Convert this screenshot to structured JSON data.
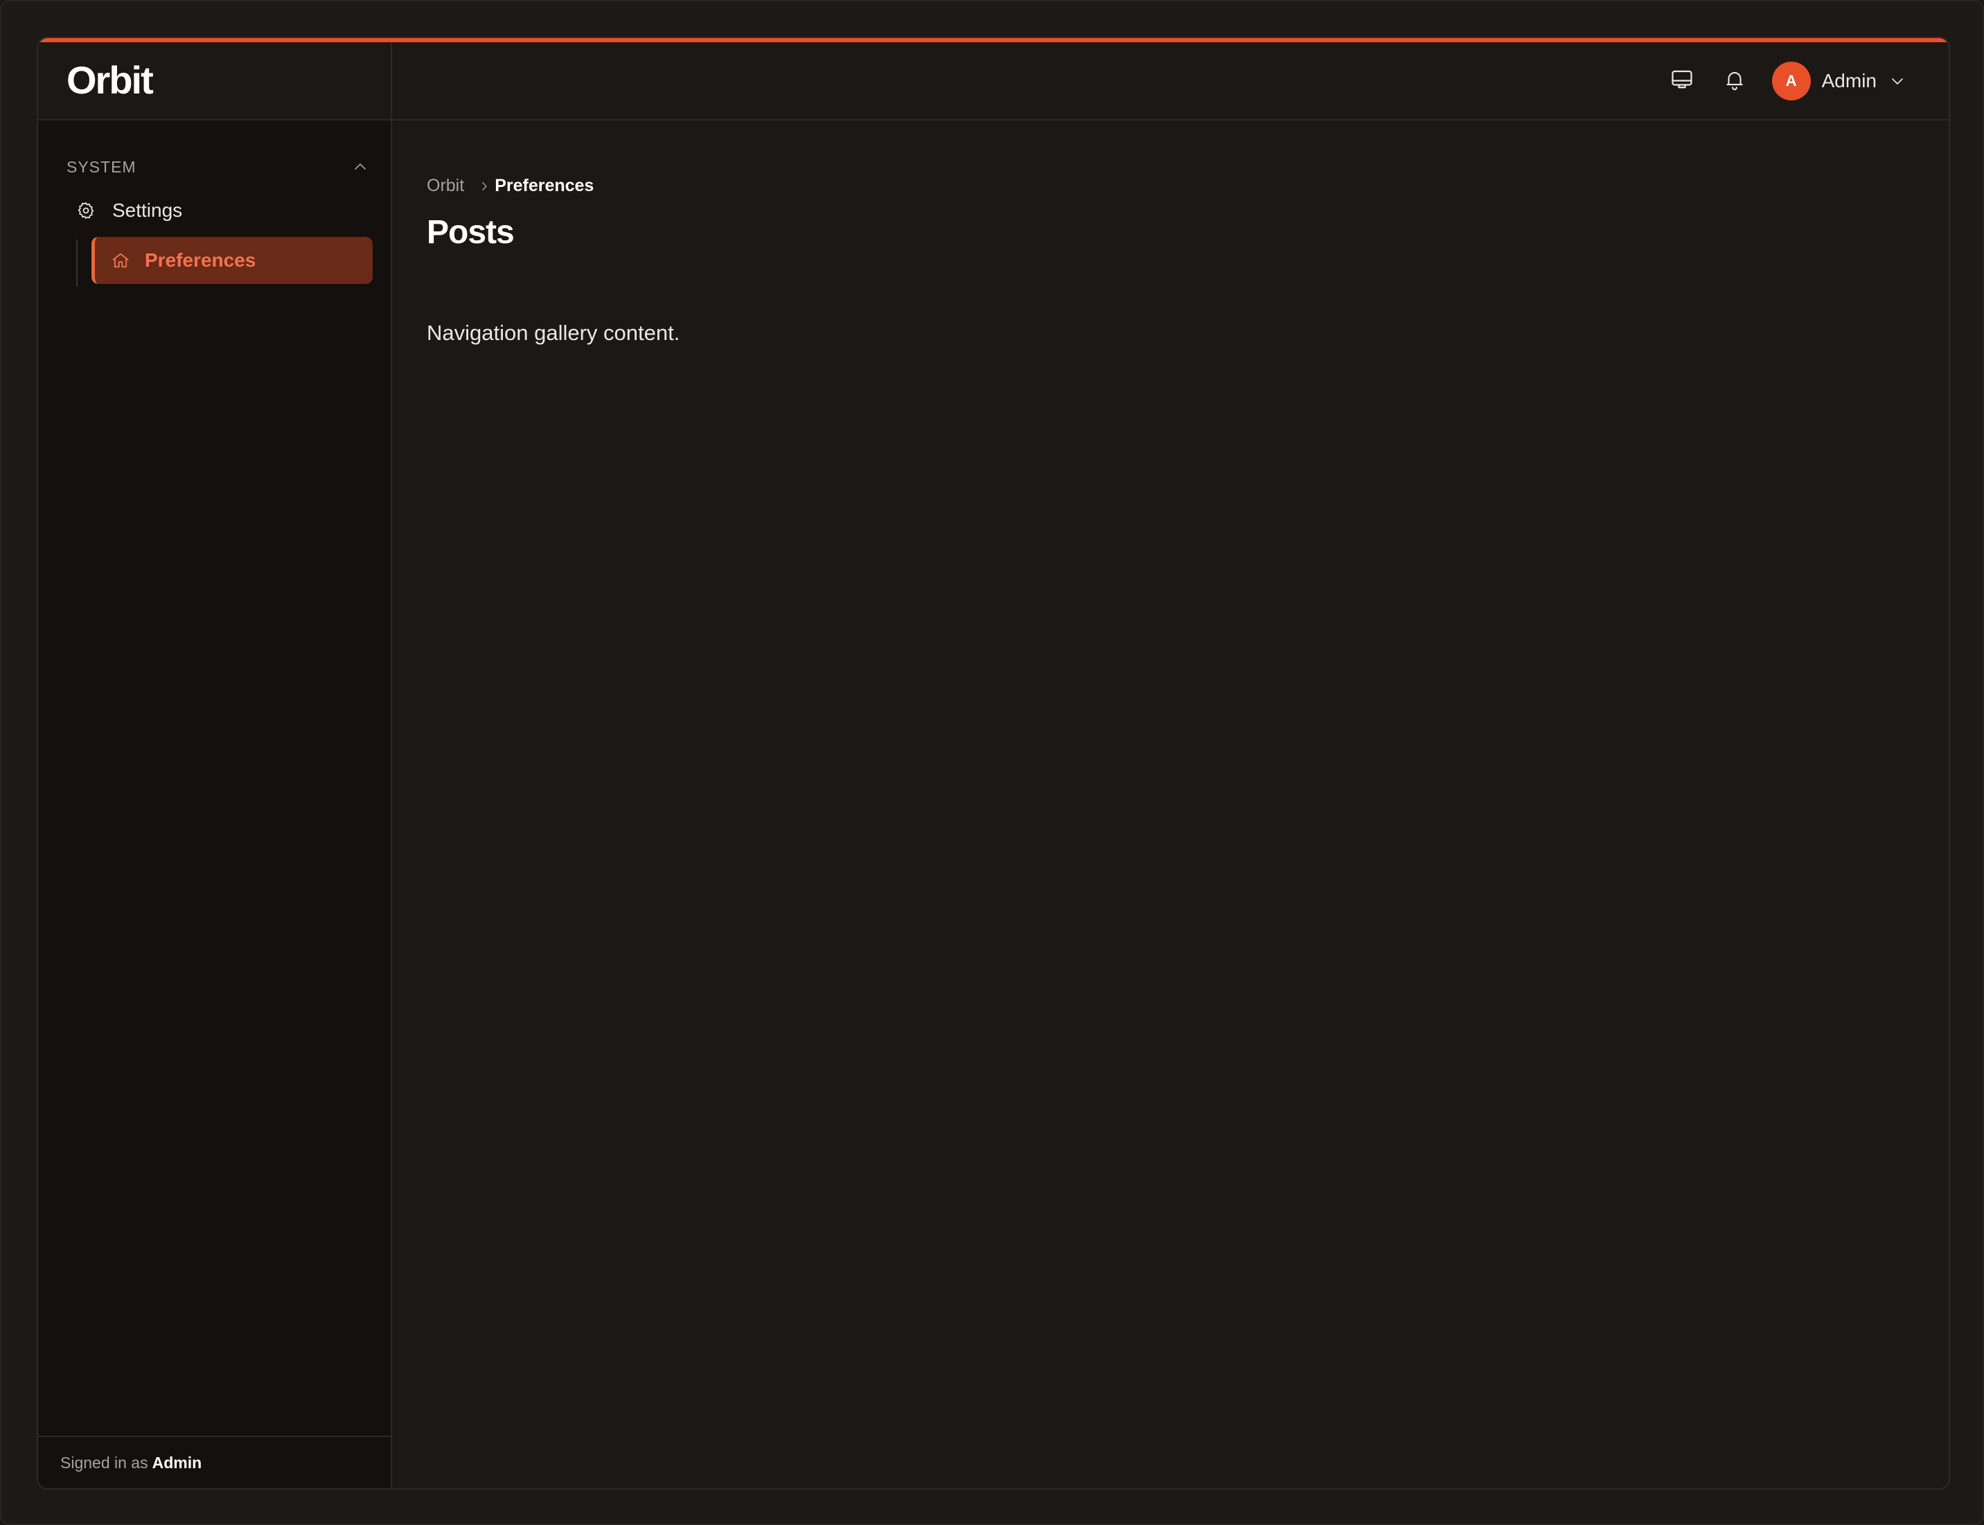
{
  "app": {
    "brand": "Orbit",
    "accent_color": "#e8502a"
  },
  "sidebar": {
    "group_label": "SYSTEM",
    "group_expanded": true,
    "items": [
      {
        "label": "Settings",
        "icon": "gear-icon",
        "active": false
      }
    ],
    "subitems": [
      {
        "label": "Preferences",
        "icon": "home-icon",
        "active": true
      }
    ],
    "footer": {
      "prefix": "Signed in as",
      "user": "Admin"
    }
  },
  "header": {
    "icons": [
      "monitor-icon",
      "bell-icon"
    ],
    "user": {
      "initial": "A",
      "name": "Admin"
    }
  },
  "main": {
    "breadcrumb": {
      "root": "Orbit",
      "current": "Preferences"
    },
    "title": "Posts",
    "body": "Navigation gallery content."
  }
}
